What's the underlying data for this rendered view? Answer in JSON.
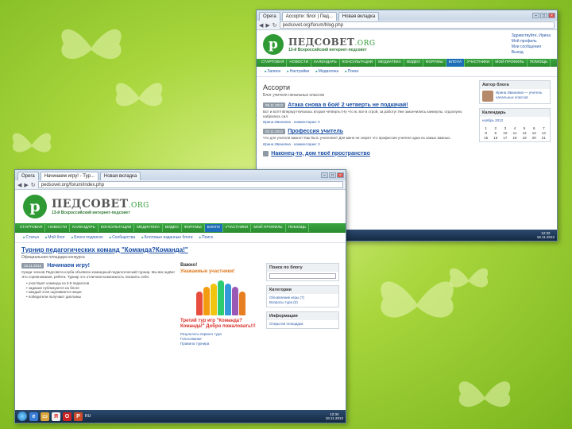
{
  "background": {
    "colors": {
      "light": "#d9f08a",
      "mid": "#a8d63c",
      "dark": "#7ab51e"
    }
  },
  "screenshot_a": {
    "tabs": [
      "Opera",
      "Ассорти: блог | Пед...",
      "Новая вкладка"
    ],
    "url": "pedsovet.org/forum/blog.php",
    "logo": {
      "mark": "р",
      "name": "ПЕДСОВЕТ",
      "domain": ".ORG",
      "tagline": "13-й Всероссийский интернет-педсовет"
    },
    "header_links": [
      "Здравствуйте, Ирина",
      "Мой профиль",
      "Мои сообщения",
      "Выход"
    ],
    "menu": [
      "СТАРТОВАЯ",
      "НОВОСТИ",
      "КАЛЕНДАРЬ",
      "КОНСУЛЬТАЦИИ",
      "МЕДИАТЕКА",
      "ВИДЕО",
      "ФОРУМЫ",
      "БЛОГИ",
      "УЧАСТНИКИ",
      "МОЙ ПРОФИЛЬ",
      "ПОМОЩЬ"
    ],
    "active_menu_index": 7,
    "submenu": [
      "Записи",
      "Настройки",
      "Медиатека",
      "Поиск"
    ],
    "page_title": "Ассорти",
    "page_sub": "Блог учителя начальных классов",
    "posts": [
      {
        "date": "09.11.2012",
        "title": "Атака снова в бой! 2 четверть не подкачай!",
        "text": "Вот и вот!!! Вперед! Началась вторая четверть! Ну что ж, все в строй, за работу! Уже закончились каникулы, отдохнули, набрались сил.",
        "author": "Ирина Ивановна",
        "comments": "комментарии: 0"
      },
      {
        "date": "02.11.2012",
        "title": "Профессия учитель",
        "text": "Что для учителя важно? Как быть учителем? Для меня не секрет что профессия учителя одна из самых важных.",
        "author": "Ирина Ивановна",
        "comments": "комментарии: 3"
      },
      {
        "date": "",
        "title": "Наконец-то, дом твоё пространство",
        "text": "",
        "author": "",
        "comments": ""
      }
    ],
    "side_panels": {
      "author": {
        "title": "Автор блога",
        "text": "Ирина Ивановна — учитель начальных классов"
      },
      "calendar": {
        "title": "Календарь",
        "month": "ноябрь 2012",
        "days": [
          "1",
          "2",
          "3",
          "4",
          "5",
          "6",
          "7",
          "8",
          "9",
          "10",
          "11",
          "12",
          "13",
          "14",
          "15",
          "16",
          "17",
          "18",
          "19",
          "20",
          "21"
        ]
      }
    },
    "taskbar": {
      "lang": "RU",
      "time": "12:32",
      "date": "18.11.2012"
    }
  },
  "screenshot_b": {
    "tabs": [
      "Opera",
      "Начинаем игру! - Тур...",
      "Новая вкладка"
    ],
    "url": "pedsovet.org/forum/index.php",
    "logo": {
      "mark": "р",
      "name": "ПЕДСОВЕТ",
      "domain": ".ORG",
      "tagline": "13-й Всероссийский интернет-педсовет"
    },
    "menu": [
      "СТАРТОВАЯ",
      "НОВОСТИ",
      "КАЛЕНДАРЬ",
      "КОНСУЛЬТАЦИИ",
      "МЕДИАТЕКА",
      "ВИДЕО",
      "ФОРУМЫ",
      "БЛОГИ",
      "УЧАСТНИКИ",
      "МОЙ ПРОФИЛЬ",
      "ПОМОЩЬ"
    ],
    "active_menu_index": 7,
    "submenu": [
      "Статьи",
      "Мой блог",
      "Блоги подписок",
      "Сообщества",
      "Блоговые изданные блоги",
      "Поиск"
    ],
    "page_title": "Турнир педагогических команд \"Команда?Команда!\"",
    "page_sub": "Официальная площадка конкурса",
    "post": {
      "date": "15.11.2012",
      "title": "Начинаем игру!",
      "text": "Среди членов Педсовета клуба объявлен командный педагогический турнир. Мы вас ждём! Это соревнования, ребята. Турнир это отличная возможность показать себя.",
      "bullets": [
        "• участвуют команды из 3-5 педагогов",
        "• задания публикуются на блоге",
        "• каждый этап оценивается жюри",
        "• победители получают дипломы"
      ]
    },
    "mid": {
      "heading": "Важно!",
      "welcome": "Уважаемые участники!",
      "cta": "Третий тур игр \"Команда?Команда!\" Добро пожаловать!!!",
      "links": [
        "Результаты первого тура",
        "Голосование",
        "Правила турнира"
      ]
    },
    "side_panels": [
      {
        "title": "Поиск по блогу",
        "text": ""
      },
      {
        "title": "Категории",
        "text": "Объявление игры (7)\nВопросы тура (2)"
      },
      {
        "title": "Информация",
        "text": "Открытая площадка"
      }
    ],
    "taskbar": {
      "lang": "RU",
      "time": "12:34",
      "date": "18.11.2012"
    }
  }
}
